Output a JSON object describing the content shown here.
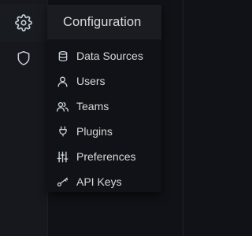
{
  "sidemenu": {
    "items": [
      {
        "icon": "gear-icon",
        "active": true
      },
      {
        "icon": "shield-icon",
        "active": false
      }
    ]
  },
  "dropdown": {
    "title": "Configuration",
    "items": [
      {
        "label": "Data Sources",
        "icon": "database-icon"
      },
      {
        "label": "Users",
        "icon": "user-icon"
      },
      {
        "label": "Teams",
        "icon": "users-icon"
      },
      {
        "label": "Plugins",
        "icon": "plug-icon"
      },
      {
        "label": "Preferences",
        "icon": "sliders-icon"
      },
      {
        "label": "API Keys",
        "icon": "key-icon"
      }
    ]
  },
  "colors": {
    "background": "#111217",
    "sidemenu_background": "#16181d",
    "header_background": "#1b1c21",
    "text": "#d8d9da",
    "icon": "#c7d0d9"
  }
}
